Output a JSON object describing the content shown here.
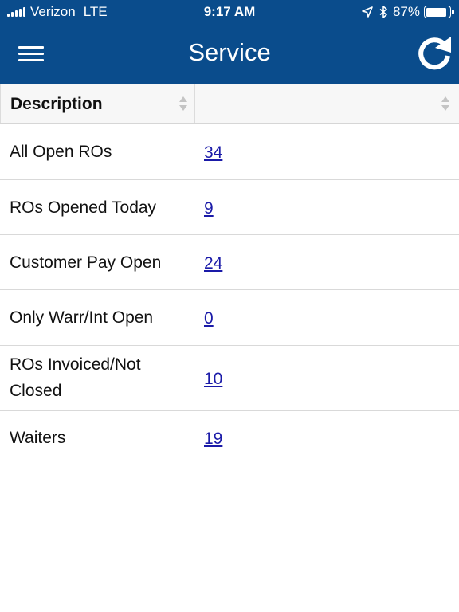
{
  "status_bar": {
    "carrier": "Verizon",
    "network": "LTE",
    "time": "9:17 AM",
    "battery": "87%",
    "battery_level": 0.87,
    "icons": [
      "signal-icon",
      "location-arrow-icon",
      "bluetooth-icon",
      "battery-icon"
    ]
  },
  "header": {
    "title": "Service",
    "menu_icon": "hamburger-menu-icon",
    "refresh_icon": "refresh-icon",
    "color": "#0a4c8c"
  },
  "table": {
    "columns": [
      "Description",
      ""
    ],
    "rows": [
      {
        "description": "All Open ROs",
        "value": "34"
      },
      {
        "description": "ROs Opened Today",
        "value": "9"
      },
      {
        "description": "Customer Pay Open",
        "value": "24"
      },
      {
        "description": "Only Warr/Int Open",
        "value": "0"
      },
      {
        "description": "ROs Invoiced/Not Closed",
        "value": "10"
      },
      {
        "description": "Waiters",
        "value": "19"
      }
    ],
    "link_color": "#1a1aa8"
  }
}
